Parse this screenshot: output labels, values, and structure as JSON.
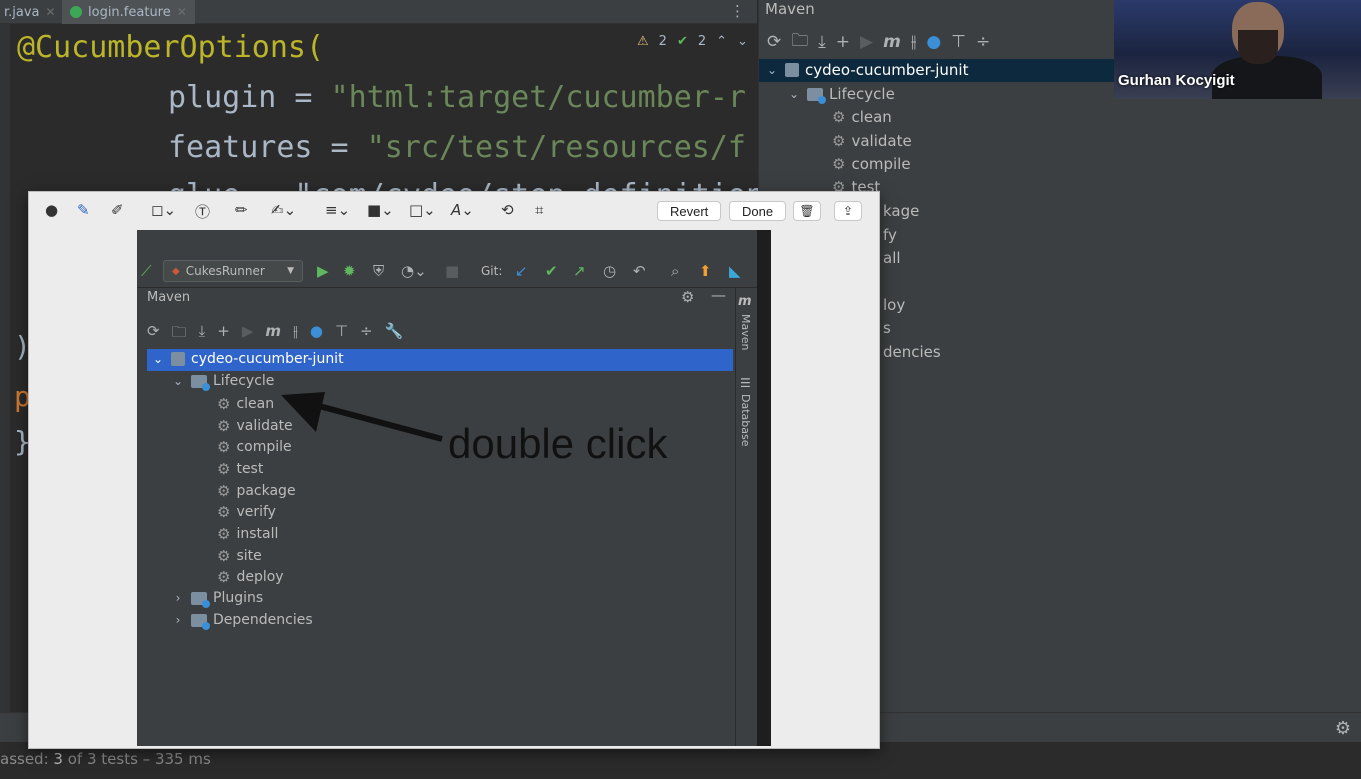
{
  "editor": {
    "tabs": [
      {
        "label": "r.java",
        "icon": "java-file-icon"
      },
      {
        "label": "login.feature",
        "icon": "cucumber-icon"
      }
    ],
    "code_lines": {
      "line1_annotation": "@CucumberOptions(",
      "line2_key": "plugin = ",
      "line2_value": "\"html:target/cucumber-r",
      "line3_key": "features = ",
      "line3_value": "\"src/test/resources/f",
      "line4_partial": "glue = \"com/cydeo/step_definitions\""
    },
    "inspections": {
      "warnings": "2",
      "weak_warnings": "2"
    }
  },
  "maven_panel": {
    "title": "Maven",
    "project": "cydeo-cucumber-junit",
    "lifecycle_label": "Lifecycle",
    "goals": [
      "clean",
      "validate",
      "compile",
      "test"
    ],
    "partial_items": [
      "kage",
      "fy",
      "all",
      "loy",
      "s",
      "dencies"
    ]
  },
  "webcam": {
    "name": "Gurhan Kocyigit"
  },
  "status": {
    "passed_label": "assed:",
    "passed_count": "3",
    "rest": "of 3 tests – 335 ms"
  },
  "markup": {
    "revert_label": "Revert",
    "done_label": "Done",
    "screenshot": {
      "run_config": "CukesRunner",
      "git_label": "Git:",
      "maven_title": "Maven",
      "project": "cydeo-cucumber-junit",
      "lifecycle_label": "Lifecycle",
      "goals": [
        "clean",
        "validate",
        "compile",
        "test",
        "package",
        "verify",
        "install",
        "site",
        "deploy"
      ],
      "plugins_label": "Plugins",
      "dependencies_label": "Dependencies",
      "side_maven": "Maven",
      "side_database": "Database"
    },
    "annotation": "double click"
  }
}
